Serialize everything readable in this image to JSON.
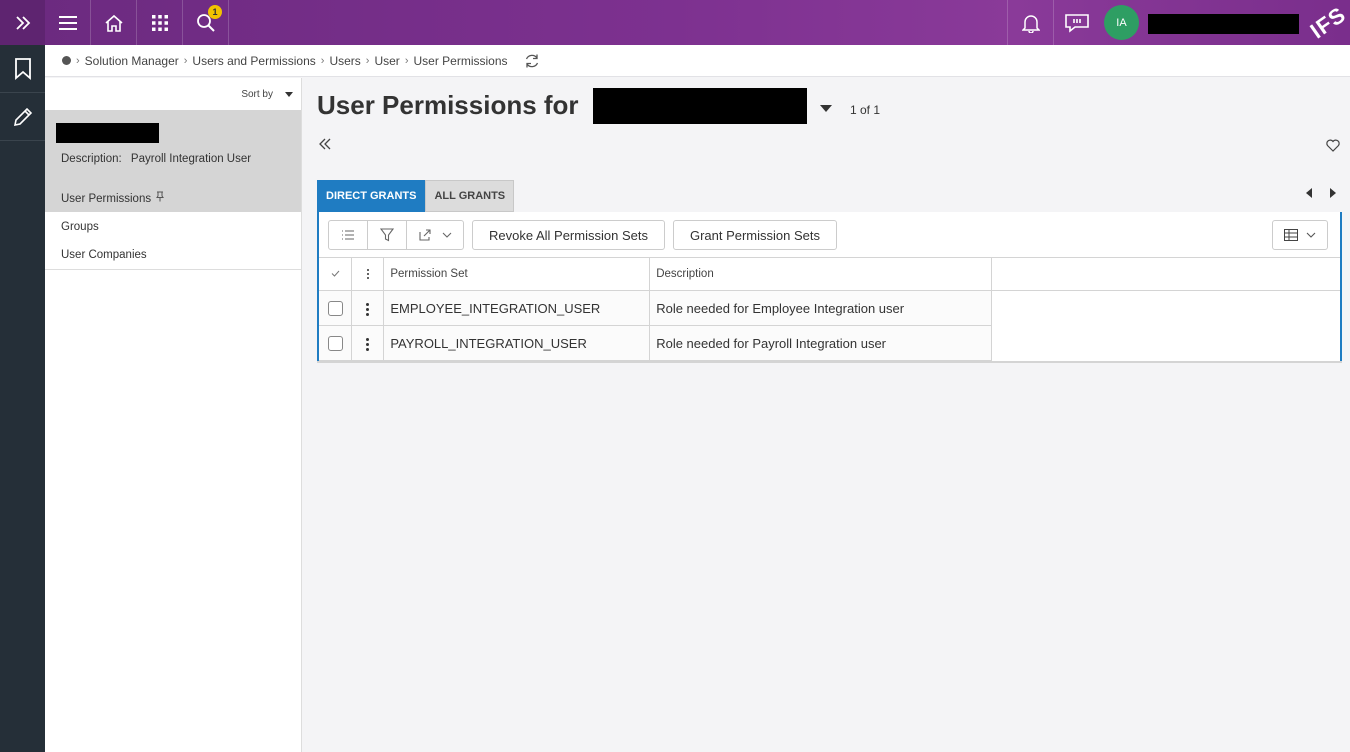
{
  "topbar": {
    "search_badge": "1",
    "avatar_initials": "IA",
    "logo_text": "IFS"
  },
  "breadcrumb": {
    "items": [
      "Solution Manager",
      "Users and Permissions",
      "Users",
      "User",
      "User Permissions"
    ]
  },
  "navpanel": {
    "sort_label": "Sort by",
    "description_label": "Description:",
    "description_value": "Payroll Integration User",
    "items": [
      "User Permissions",
      "Groups",
      "User Companies"
    ]
  },
  "main": {
    "title": "User Permissions for",
    "page_count": "1 of 1",
    "tabs": [
      "DIRECT GRANTS",
      "ALL GRANTS"
    ],
    "toolbar": {
      "revoke_label": "Revoke All Permission Sets",
      "grant_label": "Grant Permission Sets"
    },
    "table": {
      "columns": [
        "Permission Set",
        "Description"
      ],
      "rows": [
        {
          "permission_set": "EMPLOYEE_INTEGRATION_USER",
          "description": "Role needed for Employee Integration user"
        },
        {
          "permission_set": "PAYROLL_INTEGRATION_USER",
          "description": "Role needed for Payroll Integration user"
        }
      ]
    }
  },
  "colors": {
    "topbar_purple": "#7d3190",
    "accent_blue": "#1f7cc2",
    "rail_dark": "#252f38",
    "avatar_green": "#2e9e63",
    "badge_yellow": "#f2c200"
  },
  "icons": [
    "double-chevron-right-icon",
    "hamburger-icon",
    "home-icon",
    "apps-grid-icon",
    "search-icon",
    "bell-icon",
    "feedback-icon",
    "bookmark-icon",
    "pencil-icon",
    "refresh-icon",
    "double-chevron-left-icon",
    "heart-icon",
    "list-icon",
    "filter-icon",
    "export-icon",
    "table-view-icon",
    "pin-icon"
  ]
}
